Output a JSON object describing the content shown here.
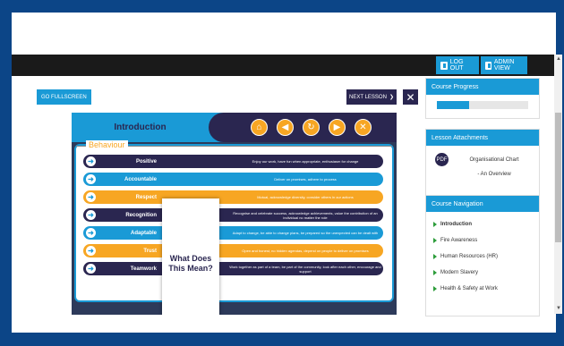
{
  "toolbar": {
    "logout_label": "LOG OUT",
    "admin_label": "ADMIN VIEW"
  },
  "controls": {
    "fullscreen_label": "GO FULLSCREEN",
    "next_lesson_label": "NEXT LESSON",
    "next_arrow": "❯",
    "close_glyph": "✕"
  },
  "lesson": {
    "title": "Introduction",
    "nav_icons": [
      "home-icon",
      "back-icon",
      "replay-icon",
      "forward-icon",
      "close-icon"
    ],
    "nav_glyphs": [
      "⌂",
      "◀",
      "↻",
      "▶",
      "✕"
    ],
    "section_title": "Behaviour",
    "mean_text": "What Does This Mean?",
    "rows": [
      {
        "label": "Positive",
        "desc": "Enjoy our work, have fun when appropriate, enthusiasm for change",
        "color": "#2a2650"
      },
      {
        "label": "Accountable",
        "desc": "Deliver on promises, adhere to process",
        "color": "#1a9ad6"
      },
      {
        "label": "Respect",
        "desc": "Mutual, acknowledge diversity, consider others in our actions",
        "color": "#f7a623"
      },
      {
        "label": "Recognition",
        "desc": "Recognise and celebrate success, acknowledge achievements, value the contribution of an individual no matter the role",
        "color": "#2a2650"
      },
      {
        "label": "Adaptable",
        "desc": "Adapt to change, be able to change plans, be prepared so the unexpected can be dealt with",
        "color": "#1a9ad6"
      },
      {
        "label": "Trust",
        "desc": "Open and honest, no hidden agendas, depend on people to deliver on promises",
        "color": "#f7a623"
      },
      {
        "label": "Teamwork",
        "desc": "Work together as part of a team, be part of the community, look after each other, encourage and support",
        "color": "#2a2650"
      }
    ]
  },
  "sidebar": {
    "progress": {
      "title": "Course Progress",
      "value": 0.35
    },
    "attachments": {
      "title": "Lesson Attachments",
      "file_line1": "Organisational Chart",
      "file_line2": "- An Overview",
      "icon_glyph": "PDF"
    },
    "navigation": {
      "title": "Course Navigation",
      "items": [
        "Introduction",
        "Fire Awareness",
        "Human Resources (HR)",
        "Modern Slavery",
        "Health & Safety at Work"
      ]
    }
  },
  "colors": {
    "brand_blue": "#1a9ad6",
    "navy": "#2a2650",
    "orange": "#f7a623",
    "page_bg": "#0c4587"
  }
}
